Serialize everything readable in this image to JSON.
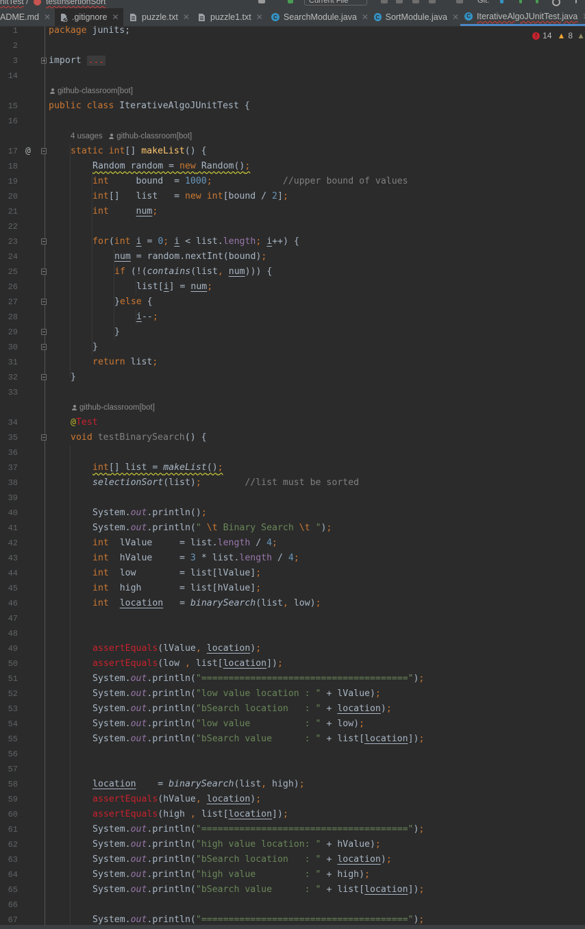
{
  "topbar": {
    "breadcrumb_left": "nitTest",
    "breadcrumb_sep": "/",
    "breadcrumb_right": "testInsertionSort",
    "run_config": "Current File",
    "git_label": "Git:"
  },
  "tabs": [
    {
      "label": "ADME.md",
      "icon": "markdown-file-icon",
      "selected": false
    },
    {
      "label": ".gitignore",
      "icon": "ignore-file-icon",
      "selected": false,
      "dark": true
    },
    {
      "label": "puzzle.txt",
      "icon": "text-file-icon",
      "selected": false
    },
    {
      "label": "puzzle1.txt",
      "icon": "text-file-icon",
      "selected": false
    },
    {
      "label": "SearchModule.java",
      "icon": "java-class-icon",
      "selected": false
    },
    {
      "label": "SortModule.java",
      "icon": "java-class-icon",
      "selected": false
    },
    {
      "label": "IterativeAlgoJUnitTest.java",
      "icon": "java-class-icon",
      "selected": true
    }
  ],
  "inspections": {
    "errors": "14",
    "warnings": "8"
  },
  "hints": {
    "author": "github-classroom[bot]",
    "usages": "4 usages"
  },
  "lines": [
    {
      "n": "1"
    },
    {
      "n": "2"
    },
    {
      "n": "3"
    },
    {
      "n": "14"
    },
    {
      "n": "15"
    },
    {
      "n": "16"
    },
    {
      "n": "17"
    },
    {
      "n": "18"
    },
    {
      "n": "19"
    },
    {
      "n": "20"
    },
    {
      "n": "21"
    },
    {
      "n": "22"
    },
    {
      "n": "23"
    },
    {
      "n": "24"
    },
    {
      "n": "25"
    },
    {
      "n": "26"
    },
    {
      "n": "27"
    },
    {
      "n": "28"
    },
    {
      "n": "29"
    },
    {
      "n": "30"
    },
    {
      "n": "31"
    },
    {
      "n": "32"
    },
    {
      "n": "33"
    },
    {
      "n": "34"
    },
    {
      "n": "35"
    },
    {
      "n": "36"
    },
    {
      "n": "37"
    },
    {
      "n": "38"
    },
    {
      "n": "39"
    },
    {
      "n": "40"
    },
    {
      "n": "41"
    },
    {
      "n": "42"
    },
    {
      "n": "43"
    },
    {
      "n": "44"
    },
    {
      "n": "45"
    },
    {
      "n": "46"
    },
    {
      "n": "47"
    },
    {
      "n": "48"
    },
    {
      "n": "49"
    },
    {
      "n": "50"
    },
    {
      "n": "51"
    },
    {
      "n": "52"
    },
    {
      "n": "53"
    },
    {
      "n": "54"
    },
    {
      "n": "55"
    },
    {
      "n": "56"
    },
    {
      "n": "57"
    },
    {
      "n": "58"
    },
    {
      "n": "59"
    },
    {
      "n": "60"
    },
    {
      "n": "61"
    },
    {
      "n": "62"
    },
    {
      "n": "63"
    },
    {
      "n": "64"
    },
    {
      "n": "65"
    },
    {
      "n": "66"
    },
    {
      "n": "67"
    }
  ],
  "code": {
    "l1_kw": "package",
    "l1_rest": " junits;",
    "l3_kw": "import",
    "l3_fold": "...",
    "l15_kw": "public class",
    "l15_name": " IterativeAlgoJUnitTest",
    "l15_brace": " {",
    "l17_kw": "static int",
    "l17_a": "[] ",
    "l17_fn": "makeList",
    "l17_b": "() {",
    "l18_a": "Random random = ",
    "l18_kw": "new",
    "l18_b": " Random()",
    "l18_semi": ";",
    "l19_kw": "int",
    "l19_a": "     bound  = ",
    "l19_num": "1000",
    "l19_semi": ";",
    "l19_pad": "             ",
    "l19_cmt": "//upper bound of values",
    "l20_kw": "int",
    "l20_a": "[]   list   = ",
    "l20_kw2": "new int",
    "l20_b": "[bound / ",
    "l20_num": "2",
    "l20_c": "]",
    "l20_semi": ";",
    "l21_kw": "int",
    "l21_a": "     ",
    "l21_var": "num",
    "l21_semi": ";",
    "l23_kw": "for",
    "l23_a": "(",
    "l23_kw2": "int",
    "l23_sp": " ",
    "l23_i": "i",
    "l23_b": " = ",
    "l23_num": "0",
    "l23_semi": ";",
    "l23_c": " ",
    "l23_i2": "i",
    "l23_d": " < list.",
    "l23_fld": "length",
    "l23_semi2": ";",
    "l23_e": " ",
    "l23_i3": "i",
    "l23_f": "++) {",
    "l24_var": "num",
    "l24_a": " = random.nextInt(bound)",
    "l24_semi": ";",
    "l25_kw": "if",
    "l25_a": " (!(",
    "l25_fn": "contains",
    "l25_b": "(list",
    "l25_comma": ",",
    "l25_sp": " ",
    "l25_var": "num",
    "l25_c": "))) {",
    "l26_a": "list[",
    "l26_i": "i",
    "l26_b": "] = ",
    "l26_var": "num",
    "l26_semi": ";",
    "l27_a": "}",
    "l27_kw": "else",
    "l27_b": " {",
    "l28_i": "i",
    "l28_a": "--",
    "l28_semi": ";",
    "l29_a": "}",
    "l30_a": "}",
    "l31_kw": "return",
    "l31_a": " list",
    "l31_semi": ";",
    "l32_a": "}",
    "l34_at": "@",
    "l34_ann": "Test",
    "l35_kw": "void",
    "l35_name": " testBinarySearch",
    "l35_a": "() {",
    "l37_kw": "int",
    "l37_a": "[] list = ",
    "l37_fn": "makeList",
    "l37_b": "()",
    "l37_semi": ";",
    "l38_fn": "selectionSort",
    "l38_a": "(list)",
    "l38_semi": ";",
    "l38_pad": "        ",
    "l38_cmt": "//list must be sorted",
    "sys": "System.",
    "out": "out",
    "println": ".println(",
    "l40_a": ")",
    "l40_semi": ";",
    "l41_q": "\" ",
    "l41_esc1": "\\t",
    "l41_str": " Binary Search ",
    "l41_esc2": "\\t",
    "l41_q2": " \"",
    "l41_a": ")",
    "l41_semi": ";",
    "l42_kw": "int",
    "l42_a": "  lValue     = list.",
    "l42_fld": "length",
    "l42_b": " / ",
    "l42_num": "4",
    "l42_semi": ";",
    "l43_kw": "int",
    "l43_a": "  hValue     = ",
    "l43_num": "3",
    "l43_b": " * list.",
    "l43_fld": "length",
    "l43_c": " / ",
    "l43_num2": "4",
    "l43_semi": ";",
    "l44_kw": "int",
    "l44_a": "  low        = list[lValue]",
    "l44_semi": ";",
    "l45_kw": "int",
    "l45_a": "  high       = list[hValue]",
    "l45_semi": ";",
    "l46_kw": "int",
    "l46_sp": "  ",
    "l46_var": "location",
    "l46_a": "   = ",
    "l46_fn": "binarySearch",
    "l46_b": "(list",
    "l46_comma": ",",
    "l46_c": " low)",
    "l46_semi": ";",
    "assert": "assertEquals",
    "l49_a": "(lValue",
    "l49_comma": ",",
    "l49_sp": " ",
    "l49_var": "location",
    "l49_b": ")",
    "l49_semi": ";",
    "l50_a": "(low ",
    "l50_comma": ",",
    "l50_b": " list[",
    "l50_var": "location",
    "l50_c": "])",
    "l50_semi": ";",
    "eqline": "\"======================================\"",
    "l51_a": ")",
    "l51_semi": ";",
    "l52_str": "\"low value location : \"",
    "l52_a": " + lValue)",
    "l52_semi": ";",
    "l53_str": "\"bSearch location   : \"",
    "l53_a": " + ",
    "l53_var": "location",
    "l53_b": ")",
    "l53_semi": ";",
    "l54_str": "\"low value          : \"",
    "l54_a": " + low)",
    "l54_semi": ";",
    "l55_str": "\"bSearch value      : \"",
    "l55_a": " + list[",
    "l55_var": "location",
    "l55_b": "])",
    "l55_semi": ";",
    "l58_var": "location",
    "l58_a": "    = ",
    "l58_fn": "binarySearch",
    "l58_b": "(list",
    "l58_comma": ",",
    "l58_c": " high)",
    "l58_semi": ";",
    "l59_a": "(hValue",
    "l59_comma": ",",
    "l59_sp": " ",
    "l59_var": "location",
    "l59_b": ")",
    "l59_semi": ";",
    "l60_a": "(high ",
    "l60_comma": ",",
    "l60_b": " list[",
    "l60_var": "location",
    "l60_c": "])",
    "l60_semi": ";",
    "l62_str": "\"high value location: \"",
    "l62_a": " + hValue)",
    "l62_semi": ";",
    "l63_str": "\"bSearch location   : \"",
    "l63_a": " + ",
    "l63_var": "location",
    "l63_b": ")",
    "l63_semi": ";",
    "l64_str": "\"high value         : \"",
    "l64_a": " + high)",
    "l64_semi": ";",
    "l65_str": "\"bSearch value      : \"",
    "l65_a": " + list[",
    "l65_var": "location",
    "l65_b": "])",
    "l65_semi": ";"
  },
  "colors": {
    "editor_bg": "#2b2b2b",
    "keyword": "#cc7832",
    "string": "#6a8759",
    "number": "#6897bb",
    "comment": "#808080",
    "field": "#9876aa",
    "error": "#c7222d",
    "tab_underline": "#4a88c7"
  }
}
